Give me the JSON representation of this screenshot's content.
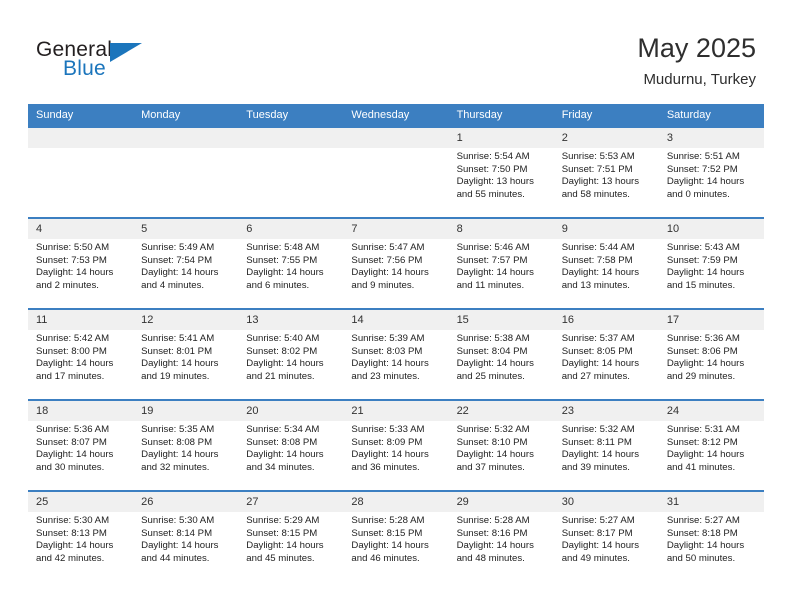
{
  "brand": {
    "name_part1": "General",
    "name_part2": "Blue",
    "accent_color": "#1b75bc",
    "triangle_icon": "triangle-logo-icon"
  },
  "header": {
    "title": "May 2025",
    "subtitle": "Mudurnu, Turkey"
  },
  "theme": {
    "header_row_bg": "#3c7fc1",
    "daynum_bg": "#f0f0f0",
    "rule_color": "#3c7fc1"
  },
  "weekday_headers": [
    "Sunday",
    "Monday",
    "Tuesday",
    "Wednesday",
    "Thursday",
    "Friday",
    "Saturday"
  ],
  "weeks": [
    [
      {
        "day": "",
        "sunrise": "",
        "sunset": "",
        "daylight": "",
        "blank": true
      },
      {
        "day": "",
        "sunrise": "",
        "sunset": "",
        "daylight": "",
        "blank": true
      },
      {
        "day": "",
        "sunrise": "",
        "sunset": "",
        "daylight": "",
        "blank": true
      },
      {
        "day": "",
        "sunrise": "",
        "sunset": "",
        "daylight": "",
        "blank": true
      },
      {
        "day": "1",
        "sunrise": "Sunrise: 5:54 AM",
        "sunset": "Sunset: 7:50 PM",
        "daylight": "Daylight: 13 hours and 55 minutes."
      },
      {
        "day": "2",
        "sunrise": "Sunrise: 5:53 AM",
        "sunset": "Sunset: 7:51 PM",
        "daylight": "Daylight: 13 hours and 58 minutes."
      },
      {
        "day": "3",
        "sunrise": "Sunrise: 5:51 AM",
        "sunset": "Sunset: 7:52 PM",
        "daylight": "Daylight: 14 hours and 0 minutes."
      }
    ],
    [
      {
        "day": "4",
        "sunrise": "Sunrise: 5:50 AM",
        "sunset": "Sunset: 7:53 PM",
        "daylight": "Daylight: 14 hours and 2 minutes."
      },
      {
        "day": "5",
        "sunrise": "Sunrise: 5:49 AM",
        "sunset": "Sunset: 7:54 PM",
        "daylight": "Daylight: 14 hours and 4 minutes."
      },
      {
        "day": "6",
        "sunrise": "Sunrise: 5:48 AM",
        "sunset": "Sunset: 7:55 PM",
        "daylight": "Daylight: 14 hours and 6 minutes."
      },
      {
        "day": "7",
        "sunrise": "Sunrise: 5:47 AM",
        "sunset": "Sunset: 7:56 PM",
        "daylight": "Daylight: 14 hours and 9 minutes."
      },
      {
        "day": "8",
        "sunrise": "Sunrise: 5:46 AM",
        "sunset": "Sunset: 7:57 PM",
        "daylight": "Daylight: 14 hours and 11 minutes."
      },
      {
        "day": "9",
        "sunrise": "Sunrise: 5:44 AM",
        "sunset": "Sunset: 7:58 PM",
        "daylight": "Daylight: 14 hours and 13 minutes."
      },
      {
        "day": "10",
        "sunrise": "Sunrise: 5:43 AM",
        "sunset": "Sunset: 7:59 PM",
        "daylight": "Daylight: 14 hours and 15 minutes."
      }
    ],
    [
      {
        "day": "11",
        "sunrise": "Sunrise: 5:42 AM",
        "sunset": "Sunset: 8:00 PM",
        "daylight": "Daylight: 14 hours and 17 minutes."
      },
      {
        "day": "12",
        "sunrise": "Sunrise: 5:41 AM",
        "sunset": "Sunset: 8:01 PM",
        "daylight": "Daylight: 14 hours and 19 minutes."
      },
      {
        "day": "13",
        "sunrise": "Sunrise: 5:40 AM",
        "sunset": "Sunset: 8:02 PM",
        "daylight": "Daylight: 14 hours and 21 minutes."
      },
      {
        "day": "14",
        "sunrise": "Sunrise: 5:39 AM",
        "sunset": "Sunset: 8:03 PM",
        "daylight": "Daylight: 14 hours and 23 minutes."
      },
      {
        "day": "15",
        "sunrise": "Sunrise: 5:38 AM",
        "sunset": "Sunset: 8:04 PM",
        "daylight": "Daylight: 14 hours and 25 minutes."
      },
      {
        "day": "16",
        "sunrise": "Sunrise: 5:37 AM",
        "sunset": "Sunset: 8:05 PM",
        "daylight": "Daylight: 14 hours and 27 minutes."
      },
      {
        "day": "17",
        "sunrise": "Sunrise: 5:36 AM",
        "sunset": "Sunset: 8:06 PM",
        "daylight": "Daylight: 14 hours and 29 minutes."
      }
    ],
    [
      {
        "day": "18",
        "sunrise": "Sunrise: 5:36 AM",
        "sunset": "Sunset: 8:07 PM",
        "daylight": "Daylight: 14 hours and 30 minutes."
      },
      {
        "day": "19",
        "sunrise": "Sunrise: 5:35 AM",
        "sunset": "Sunset: 8:08 PM",
        "daylight": "Daylight: 14 hours and 32 minutes."
      },
      {
        "day": "20",
        "sunrise": "Sunrise: 5:34 AM",
        "sunset": "Sunset: 8:08 PM",
        "daylight": "Daylight: 14 hours and 34 minutes."
      },
      {
        "day": "21",
        "sunrise": "Sunrise: 5:33 AM",
        "sunset": "Sunset: 8:09 PM",
        "daylight": "Daylight: 14 hours and 36 minutes."
      },
      {
        "day": "22",
        "sunrise": "Sunrise: 5:32 AM",
        "sunset": "Sunset: 8:10 PM",
        "daylight": "Daylight: 14 hours and 37 minutes."
      },
      {
        "day": "23",
        "sunrise": "Sunrise: 5:32 AM",
        "sunset": "Sunset: 8:11 PM",
        "daylight": "Daylight: 14 hours and 39 minutes."
      },
      {
        "day": "24",
        "sunrise": "Sunrise: 5:31 AM",
        "sunset": "Sunset: 8:12 PM",
        "daylight": "Daylight: 14 hours and 41 minutes."
      }
    ],
    [
      {
        "day": "25",
        "sunrise": "Sunrise: 5:30 AM",
        "sunset": "Sunset: 8:13 PM",
        "daylight": "Daylight: 14 hours and 42 minutes."
      },
      {
        "day": "26",
        "sunrise": "Sunrise: 5:30 AM",
        "sunset": "Sunset: 8:14 PM",
        "daylight": "Daylight: 14 hours and 44 minutes."
      },
      {
        "day": "27",
        "sunrise": "Sunrise: 5:29 AM",
        "sunset": "Sunset: 8:15 PM",
        "daylight": "Daylight: 14 hours and 45 minutes."
      },
      {
        "day": "28",
        "sunrise": "Sunrise: 5:28 AM",
        "sunset": "Sunset: 8:15 PM",
        "daylight": "Daylight: 14 hours and 46 minutes."
      },
      {
        "day": "29",
        "sunrise": "Sunrise: 5:28 AM",
        "sunset": "Sunset: 8:16 PM",
        "daylight": "Daylight: 14 hours and 48 minutes."
      },
      {
        "day": "30",
        "sunrise": "Sunrise: 5:27 AM",
        "sunset": "Sunset: 8:17 PM",
        "daylight": "Daylight: 14 hours and 49 minutes."
      },
      {
        "day": "31",
        "sunrise": "Sunrise: 5:27 AM",
        "sunset": "Sunset: 8:18 PM",
        "daylight": "Daylight: 14 hours and 50 minutes."
      }
    ]
  ]
}
